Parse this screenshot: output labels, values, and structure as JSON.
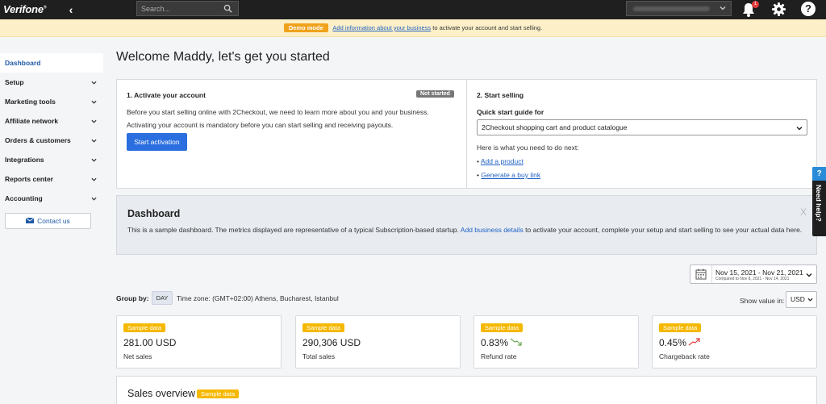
{
  "topbar": {
    "logo": "Verifone",
    "search_placeholder": "Search...",
    "notification_count": "1"
  },
  "banner": {
    "pill": "Demo mode",
    "link": "Add information about your business",
    "text": "to activate your account and start selling."
  },
  "sidebar": {
    "items": [
      {
        "label": "Dashboard"
      },
      {
        "label": "Setup"
      },
      {
        "label": "Marketing tools"
      },
      {
        "label": "Affiliate network"
      },
      {
        "label": "Orders & customers"
      },
      {
        "label": "Integrations"
      },
      {
        "label": "Reports center"
      },
      {
        "label": "Accounting"
      }
    ],
    "contact": "Contact us"
  },
  "main": {
    "welcome": "Welcome Maddy, let's get you started",
    "activate": {
      "title": "1. Activate your account",
      "badge": "Not started",
      "line1": "Before you start selling online with 2Checkout, we need to learn more about you and your business.",
      "line2": "Activating your account is mandatory before you can start selling and receiving payouts.",
      "button": "Start activation"
    },
    "start": {
      "title": "2. Start selling",
      "qs_label": "Quick start guide for",
      "qs_value": "2Checkout shopping cart and product catalogue",
      "next": "Here is what you need to do next:",
      "bullet": "•",
      "link1": "Add a product",
      "link2": "Generate a buy link"
    },
    "dashboard": {
      "title": "Dashboard",
      "text_before": "This is a sample dashboard. The metrics displayed are representative of a typical Subscription-based startup.",
      "link": "Add business details",
      "text_after": "to activate your account, complete your setup and start selling to see your actual data here.",
      "close": "X"
    },
    "date": {
      "range": "Nov 15, 2021 - Nov 21, 2021",
      "compare": "Compared to Nov 8, 2021 - Nov 14, 2021"
    },
    "group": {
      "label": "Group by:",
      "day": "DAY",
      "tz": "Time zone: (GMT+02:00) Athens, Bucharest, Istanbul",
      "show": "Show value in:",
      "currency": "USD"
    },
    "sample": "Sample data",
    "metrics": [
      {
        "value": "281.00 USD",
        "label": "Net sales"
      },
      {
        "value": "290,306 USD",
        "label": "Total sales"
      },
      {
        "value": "0.83%",
        "label": "Refund rate",
        "trend": "down"
      },
      {
        "value": "0.45%",
        "label": "Chargeback rate",
        "trend": "up"
      }
    ],
    "sales_overview": "Sales overview"
  },
  "need_help": {
    "q": "?",
    "label": "Need help?"
  },
  "colors": {
    "primary": "#2a6ee0",
    "sample": "#f5b800",
    "demo": "#f0a21c",
    "trend_up": "#e23b3b",
    "trend_down": "#6aa84f"
  }
}
